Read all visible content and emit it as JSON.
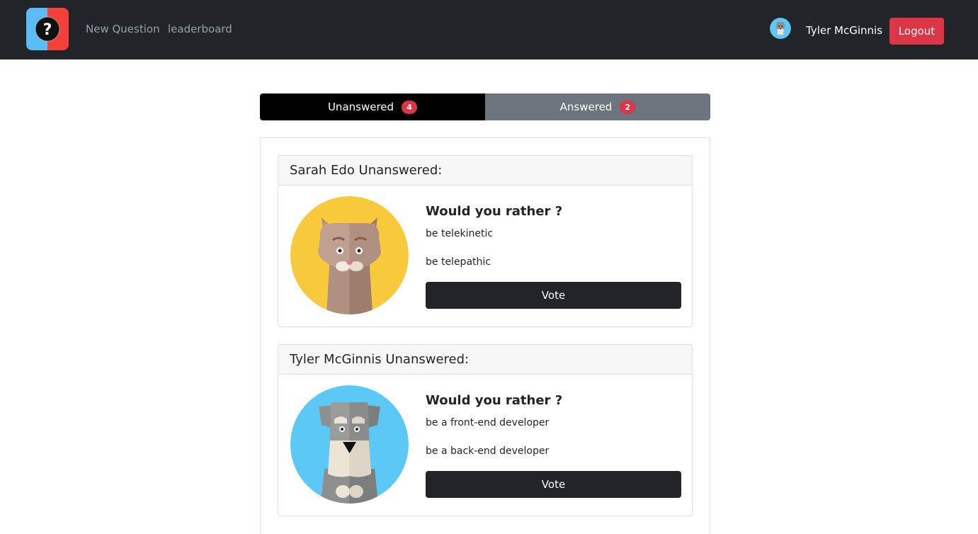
{
  "nav": {
    "logo_icon": "question-mark-logo-icon",
    "links": [
      "New Question",
      "leaderboard"
    ],
    "user_name": "Tyler McGinnis",
    "logout_label": "Logout"
  },
  "tabs": [
    {
      "label": "Unanswered",
      "count": "4",
      "active": true
    },
    {
      "label": "Answered",
      "count": "2",
      "active": false
    }
  ],
  "questions": [
    {
      "header": "Sarah Edo Unanswered:",
      "avatar_icon": "cat-avatar-icon",
      "title": "Would you rather ?",
      "option_one": "be telekinetic",
      "option_two": "be telepathic",
      "vote_label": "Vote"
    },
    {
      "header": "Tyler McGinnis Unanswered:",
      "avatar_icon": "dog-avatar-icon",
      "title": "Would you rather ?",
      "option_one": "be a front-end developer",
      "option_two": "be a back-end developer",
      "vote_label": "Vote"
    }
  ],
  "colors": {
    "navbar": "#212529",
    "danger": "#dc3545",
    "tab_active": "#000000",
    "tab_inactive": "#6c757d",
    "cat_bg": "#f8c93a",
    "dog_bg": "#5bc8f5"
  }
}
